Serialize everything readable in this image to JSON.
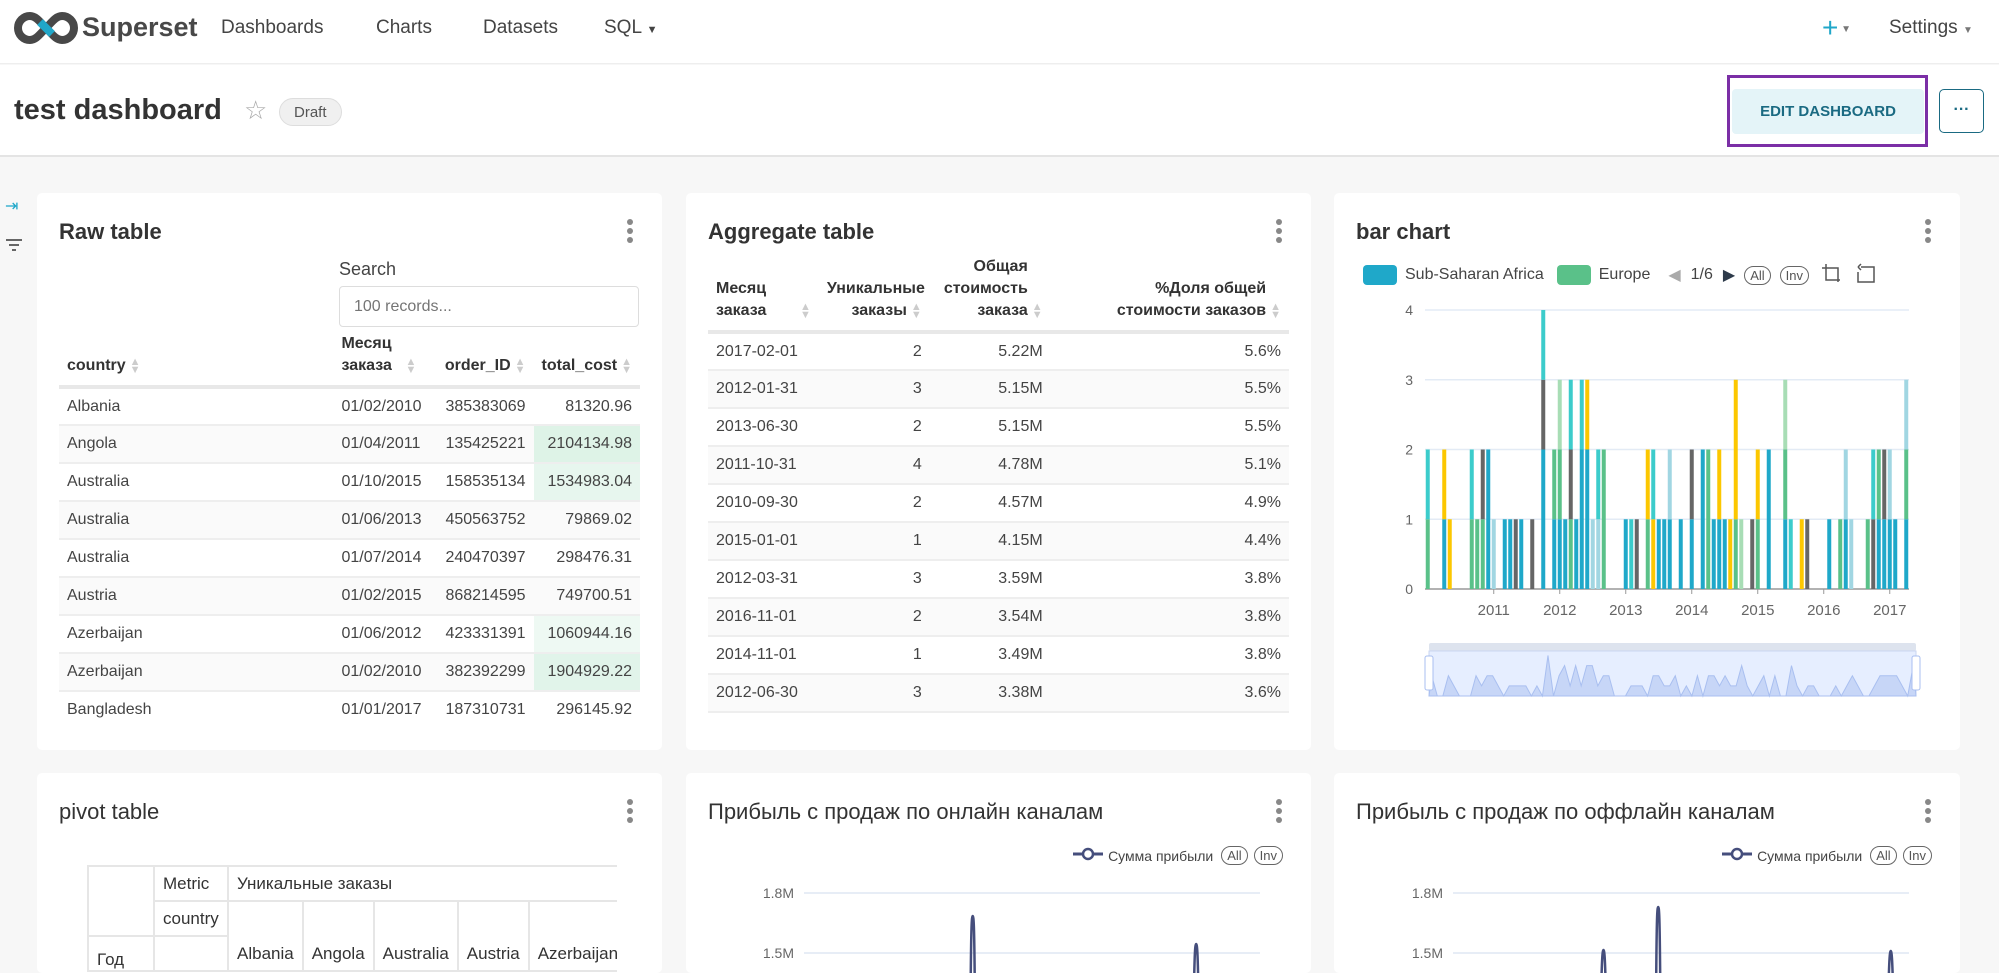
{
  "navbar": {
    "brand": "Superset",
    "links": [
      "Dashboards",
      "Charts",
      "Datasets",
      "SQL"
    ],
    "plus_label": "+",
    "settings_label": "Settings"
  },
  "header": {
    "title": "test dashboard",
    "status_badge": "Draft",
    "edit_button": "EDIT DASHBOARD",
    "more_button": "···"
  },
  "colors": {
    "accent": "#20a7c9",
    "highlight_border": "#7b2fa6",
    "edit_bg": "#e4f4f8",
    "edit_text": "#1a6a82"
  },
  "raw_table": {
    "title": "Raw table",
    "search_label": "Search",
    "search_placeholder": "100 records...",
    "columns": [
      "country",
      "Месяц заказа",
      "order_ID",
      "total_cost"
    ],
    "rows": [
      [
        "Albania",
        "01/02/2010",
        "385383069",
        "81320.96"
      ],
      [
        "Angola",
        "01/04/2011",
        "135425221",
        "2104134.98"
      ],
      [
        "Australia",
        "01/10/2015",
        "158535134",
        "1534983.04"
      ],
      [
        "Australia",
        "01/06/2013",
        "450563752",
        "79869.02"
      ],
      [
        "Australia",
        "01/07/2014",
        "240470397",
        "298476.31"
      ],
      [
        "Austria",
        "01/02/2015",
        "868214595",
        "749700.51"
      ],
      [
        "Azerbaijan",
        "01/06/2012",
        "423331391",
        "1060944.16"
      ],
      [
        "Azerbaijan",
        "01/02/2010",
        "382392299",
        "1904929.22"
      ],
      [
        "Bangladesh",
        "01/01/2017",
        "187310731",
        "296145.92"
      ]
    ]
  },
  "aggregate_table": {
    "title": "Aggregate table",
    "columns": [
      "Месяц заказа",
      "Уникальные заказы",
      "Общая стоимость заказа",
      "%Доля общей стоимости заказов"
    ],
    "rows": [
      [
        "2017-02-01",
        "2",
        "5.22M",
        "5.6%"
      ],
      [
        "2012-01-31",
        "3",
        "5.15M",
        "5.5%"
      ],
      [
        "2013-06-30",
        "2",
        "5.15M",
        "5.5%"
      ],
      [
        "2011-10-31",
        "4",
        "4.78M",
        "5.1%"
      ],
      [
        "2010-09-30",
        "2",
        "4.57M",
        "4.9%"
      ],
      [
        "2015-01-01",
        "1",
        "4.15M",
        "4.4%"
      ],
      [
        "2012-03-31",
        "3",
        "3.59M",
        "3.8%"
      ],
      [
        "2016-11-01",
        "2",
        "3.54M",
        "3.8%"
      ],
      [
        "2014-11-01",
        "1",
        "3.49M",
        "3.8%"
      ],
      [
        "2012-06-30",
        "3",
        "3.38M",
        "3.6%"
      ]
    ]
  },
  "pivot_table": {
    "title": "pivot table",
    "metric_label": "Metric",
    "metric_value": "Уникальные заказы",
    "column_label": "country",
    "row_label": "Год",
    "countries": [
      "Albania",
      "Angola",
      "Australia",
      "Austria",
      "Azerbaijan"
    ]
  },
  "chart_data": [
    {
      "type": "bar",
      "title": "bar chart",
      "stacked": true,
      "legend": {
        "page": "1/6",
        "all_label": "All",
        "inv_label": "Inv",
        "placement": "top-left"
      },
      "series": [
        {
          "key": "ssa",
          "name": "Sub-Saharan Africa",
          "color": "#1fa8c9"
        },
        {
          "key": "eu",
          "name": "Europe",
          "color": "#5ac189"
        },
        {
          "key": "s3",
          "color": "#3ccccb"
        },
        {
          "key": "s4",
          "color": "#fcc700"
        },
        {
          "key": "s5",
          "color": "#666666"
        },
        {
          "key": "s6",
          "color": "#a1d6e2"
        },
        {
          "key": "s7",
          "color": "#a8ddb5"
        }
      ],
      "bars": [
        {
          "month": "2010-01",
          "stack": {
            "eu": 1,
            "s3": 1
          }
        },
        {
          "month": "2010-04",
          "stack": {
            "ssa": 1,
            "s4": 1
          }
        },
        {
          "month": "2010-05",
          "stack": {
            "s4": 1
          }
        },
        {
          "month": "2010-09",
          "stack": {
            "eu": 1,
            "s3": 1
          }
        },
        {
          "month": "2010-10",
          "stack": {
            "eu": 1
          }
        },
        {
          "month": "2010-11",
          "stack": {
            "eu": 1,
            "s5": 1
          }
        },
        {
          "month": "2010-12",
          "stack": {
            "ssa": 2
          }
        },
        {
          "month": "2011-01",
          "stack": {
            "s6": 1
          }
        },
        {
          "month": "2011-03",
          "stack": {
            "ssa": 1
          }
        },
        {
          "month": "2011-04",
          "stack": {
            "ssa": 1
          }
        },
        {
          "month": "2011-05",
          "stack": {
            "s5": 1
          }
        },
        {
          "month": "2011-06",
          "stack": {
            "ssa": 1
          }
        },
        {
          "month": "2011-08",
          "stack": {
            "s5": 1
          }
        },
        {
          "month": "2011-10",
          "stack": {
            "ssa": 2,
            "s5": 1,
            "s3": 1
          }
        },
        {
          "month": "2011-12",
          "stack": {
            "ssa": 1,
            "eu": 1
          }
        },
        {
          "month": "2012-01",
          "stack": {
            "ssa": 1,
            "eu": 1,
            "s7": 1
          }
        },
        {
          "month": "2012-02",
          "stack": {
            "ssa": 1
          }
        },
        {
          "month": "2012-03",
          "stack": {
            "eu": 1,
            "s5": 1,
            "s3": 1
          }
        },
        {
          "month": "2012-04",
          "stack": {
            "ssa": 1
          }
        },
        {
          "month": "2012-05",
          "stack": {
            "ssa": 2,
            "s3": 1
          }
        },
        {
          "month": "2012-06",
          "stack": {
            "ssa": 2,
            "s4": 1
          }
        },
        {
          "month": "2012-07",
          "stack": {
            "s6": 1
          }
        },
        {
          "month": "2012-08",
          "stack": {
            "s6": 1,
            "s3": 1
          }
        },
        {
          "month": "2012-09",
          "stack": {
            "eu": 2
          }
        },
        {
          "month": "2013-01",
          "stack": {
            "ssa": 1
          }
        },
        {
          "month": "2013-02",
          "stack": {
            "s3": 1
          }
        },
        {
          "month": "2013-03",
          "stack": {
            "s5": 1
          }
        },
        {
          "month": "2013-05",
          "stack": {
            "eu": 1,
            "s4": 1
          }
        },
        {
          "month": "2013-06",
          "stack": {
            "s4": 1,
            "s3": 1
          }
        },
        {
          "month": "2013-07",
          "stack": {
            "ssa": 1
          }
        },
        {
          "month": "2013-08",
          "stack": {
            "ssa": 1
          }
        },
        {
          "month": "2013-09",
          "stack": {
            "ssa": 1,
            "s6": 1
          }
        },
        {
          "month": "2013-11",
          "stack": {
            "ssa": 1
          }
        },
        {
          "month": "2014-01",
          "stack": {
            "ssa": 1,
            "s5": 1
          }
        },
        {
          "month": "2014-03",
          "stack": {
            "ssa": 2
          }
        },
        {
          "month": "2014-04",
          "stack": {
            "eu": 2
          }
        },
        {
          "month": "2014-05",
          "stack": {
            "ssa": 1
          }
        },
        {
          "month": "2014-06",
          "stack": {
            "ssa": 1,
            "s4": 1
          }
        },
        {
          "month": "2014-07",
          "stack": {
            "ssa": 1
          }
        },
        {
          "month": "2014-08",
          "stack": {
            "s4": 1
          }
        },
        {
          "month": "2014-09",
          "stack": {
            "eu": 1,
            "s4": 2
          }
        },
        {
          "month": "2014-10",
          "stack": {
            "s7": 1
          }
        },
        {
          "month": "2014-12",
          "stack": {
            "s5": 1
          }
        },
        {
          "month": "2015-01",
          "stack": {
            "eu": 1,
            "s4": 1
          }
        },
        {
          "month": "2015-03",
          "stack": {
            "ssa": 2
          }
        },
        {
          "month": "2015-06",
          "stack": {
            "ssa": 1,
            "eu": 1,
            "s7": 1
          }
        },
        {
          "month": "2015-07",
          "stack": {
            "s3": 1
          }
        },
        {
          "month": "2015-09",
          "stack": {
            "s4": 1
          }
        },
        {
          "month": "2015-10",
          "stack": {
            "s5": 1
          }
        },
        {
          "month": "2016-02",
          "stack": {
            "ssa": 1
          }
        },
        {
          "month": "2016-04",
          "stack": {
            "eu": 1
          }
        },
        {
          "month": "2016-05",
          "stack": {
            "ssa": 1,
            "s6": 1
          }
        },
        {
          "month": "2016-06",
          "stack": {
            "s6": 1
          }
        },
        {
          "month": "2016-09",
          "stack": {
            "eu": 1
          }
        },
        {
          "month": "2016-10",
          "stack": {
            "s5": 1,
            "s3": 1
          }
        },
        {
          "month": "2016-11",
          "stack": {
            "ssa": 1,
            "eu": 1
          }
        },
        {
          "month": "2016-12",
          "stack": {
            "ssa": 1,
            "s5": 1
          }
        },
        {
          "month": "2017-01",
          "stack": {
            "ssa": 1,
            "s6": 1
          }
        },
        {
          "month": "2017-02",
          "stack": {
            "ssa": 1
          }
        },
        {
          "month": "2017-04",
          "stack": {
            "ssa": 1,
            "eu": 1,
            "s6": 1
          }
        }
      ],
      "xlim": [
        "2010-01",
        "2017-04"
      ],
      "x_ticks": [
        "2011",
        "2012",
        "2013",
        "2014",
        "2015",
        "2016",
        "2017"
      ],
      "y_ticks": [
        "0",
        "1",
        "2",
        "3",
        "4"
      ],
      "ylim": [
        0,
        4
      ],
      "grid": true,
      "zoom_slider": true
    },
    {
      "type": "line",
      "title": "Прибыль с продаж по онлайн каналам",
      "legend": {
        "series_name": "Сумма прибыли",
        "all_label": "All",
        "inv_label": "Inv",
        "placement": "top-right"
      },
      "color": "#454e7c",
      "y_ticks": [
        "1.8M",
        "1.5M"
      ],
      "visible_peaks": [
        1685000,
        1545000
      ]
    },
    {
      "type": "line",
      "title": "Прибыль с продаж по оффлайн каналам",
      "legend": {
        "series_name": "Сумма прибыли",
        "all_label": "All",
        "inv_label": "Inv",
        "placement": "top-right"
      },
      "color": "#454e7c",
      "y_ticks": [
        "1.8M",
        "1.5M"
      ],
      "visible_peaks": [
        1515000,
        1730000,
        1510000
      ]
    }
  ]
}
